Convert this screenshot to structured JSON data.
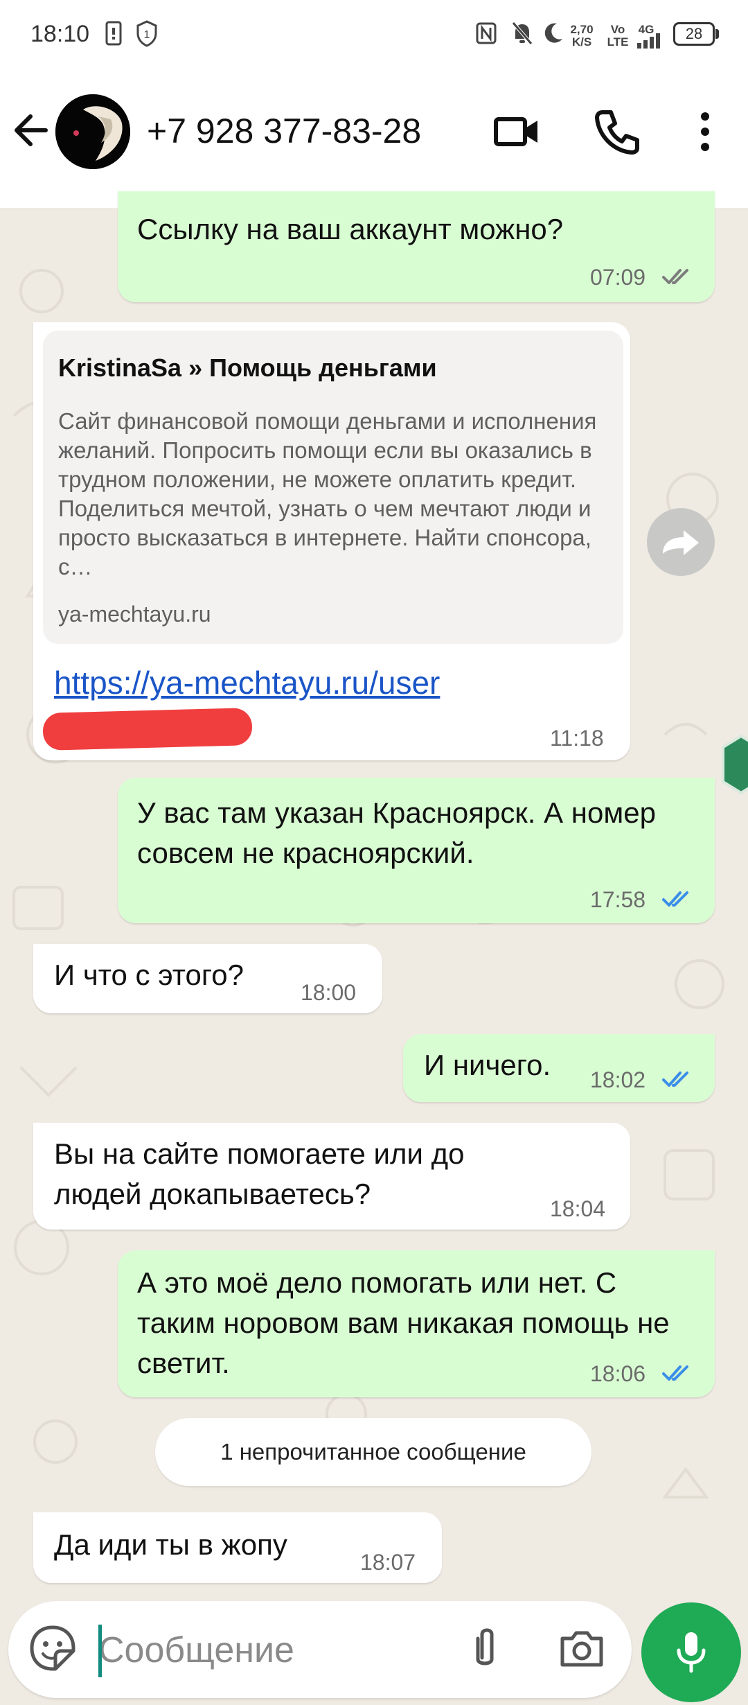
{
  "status_bar": {
    "time": "18:10",
    "net_speed_value": "2,70",
    "net_speed_unit": "K/S",
    "volte_top": "Vo",
    "volte_bottom": "LTE",
    "network": "4G",
    "battery": "28"
  },
  "header": {
    "contact_name": "+7 928 377-83-28"
  },
  "messages": [
    {
      "direction": "out",
      "text": "Ссылку на ваш аккаунт можно?",
      "time": "07:09",
      "status": "read-grey"
    },
    {
      "direction": "in",
      "link_preview": {
        "title": "KristinaSa » Помощь деньгами",
        "description": "Сайт финансовой помощи деньгами и исполнения желаний. Попросить помощи если вы оказались в трудном положении, не можете оплатить кредит. Поделиться мечтой, узнать о чем мечтают люди и просто высказаться в интернете. Найти спонсора, с…",
        "domain": "ya-mechtayu.ru"
      },
      "link_text": "https://ya-mechtayu.ru/user",
      "time": "11:18"
    },
    {
      "direction": "out",
      "text": "У вас там указан Красноярск. А номер совсем не красноярский.",
      "time": "17:58",
      "status": "read-blue"
    },
    {
      "direction": "in",
      "text": "И что с этого?",
      "time": "18:00"
    },
    {
      "direction": "out",
      "text": "И ничего.",
      "time": "18:02",
      "status": "read-blue"
    },
    {
      "direction": "in",
      "text": "Вы на сайте помогаете или до людей докапываетесь?",
      "time": "18:04"
    },
    {
      "direction": "out",
      "text": "А это моё дело помогать или нет. С таким норовом вам никакая помощь не светит.",
      "time": "18:06",
      "status": "read-blue"
    },
    {
      "direction": "in",
      "text": "Да иди ты в жопу",
      "time": "18:07"
    }
  ],
  "unread_divider": "1 непрочитанное сообщение",
  "composer": {
    "placeholder": "Сообщение"
  },
  "icons": {
    "back": "arrow-left-icon",
    "video": "video-camera-icon",
    "call": "phone-icon",
    "menu": "more-vertical-icon",
    "forward": "forward-icon",
    "emoji": "sticker-emoji-icon",
    "attach": "paperclip-icon",
    "camera": "camera-icon",
    "mic": "microphone-icon"
  },
  "colors": {
    "outgoing_bubble": "#d9fdd3",
    "incoming_bubble": "#ffffff",
    "read_ticks": "#3b8ee8",
    "link": "#1a55c7",
    "accent": "#1faa56"
  }
}
